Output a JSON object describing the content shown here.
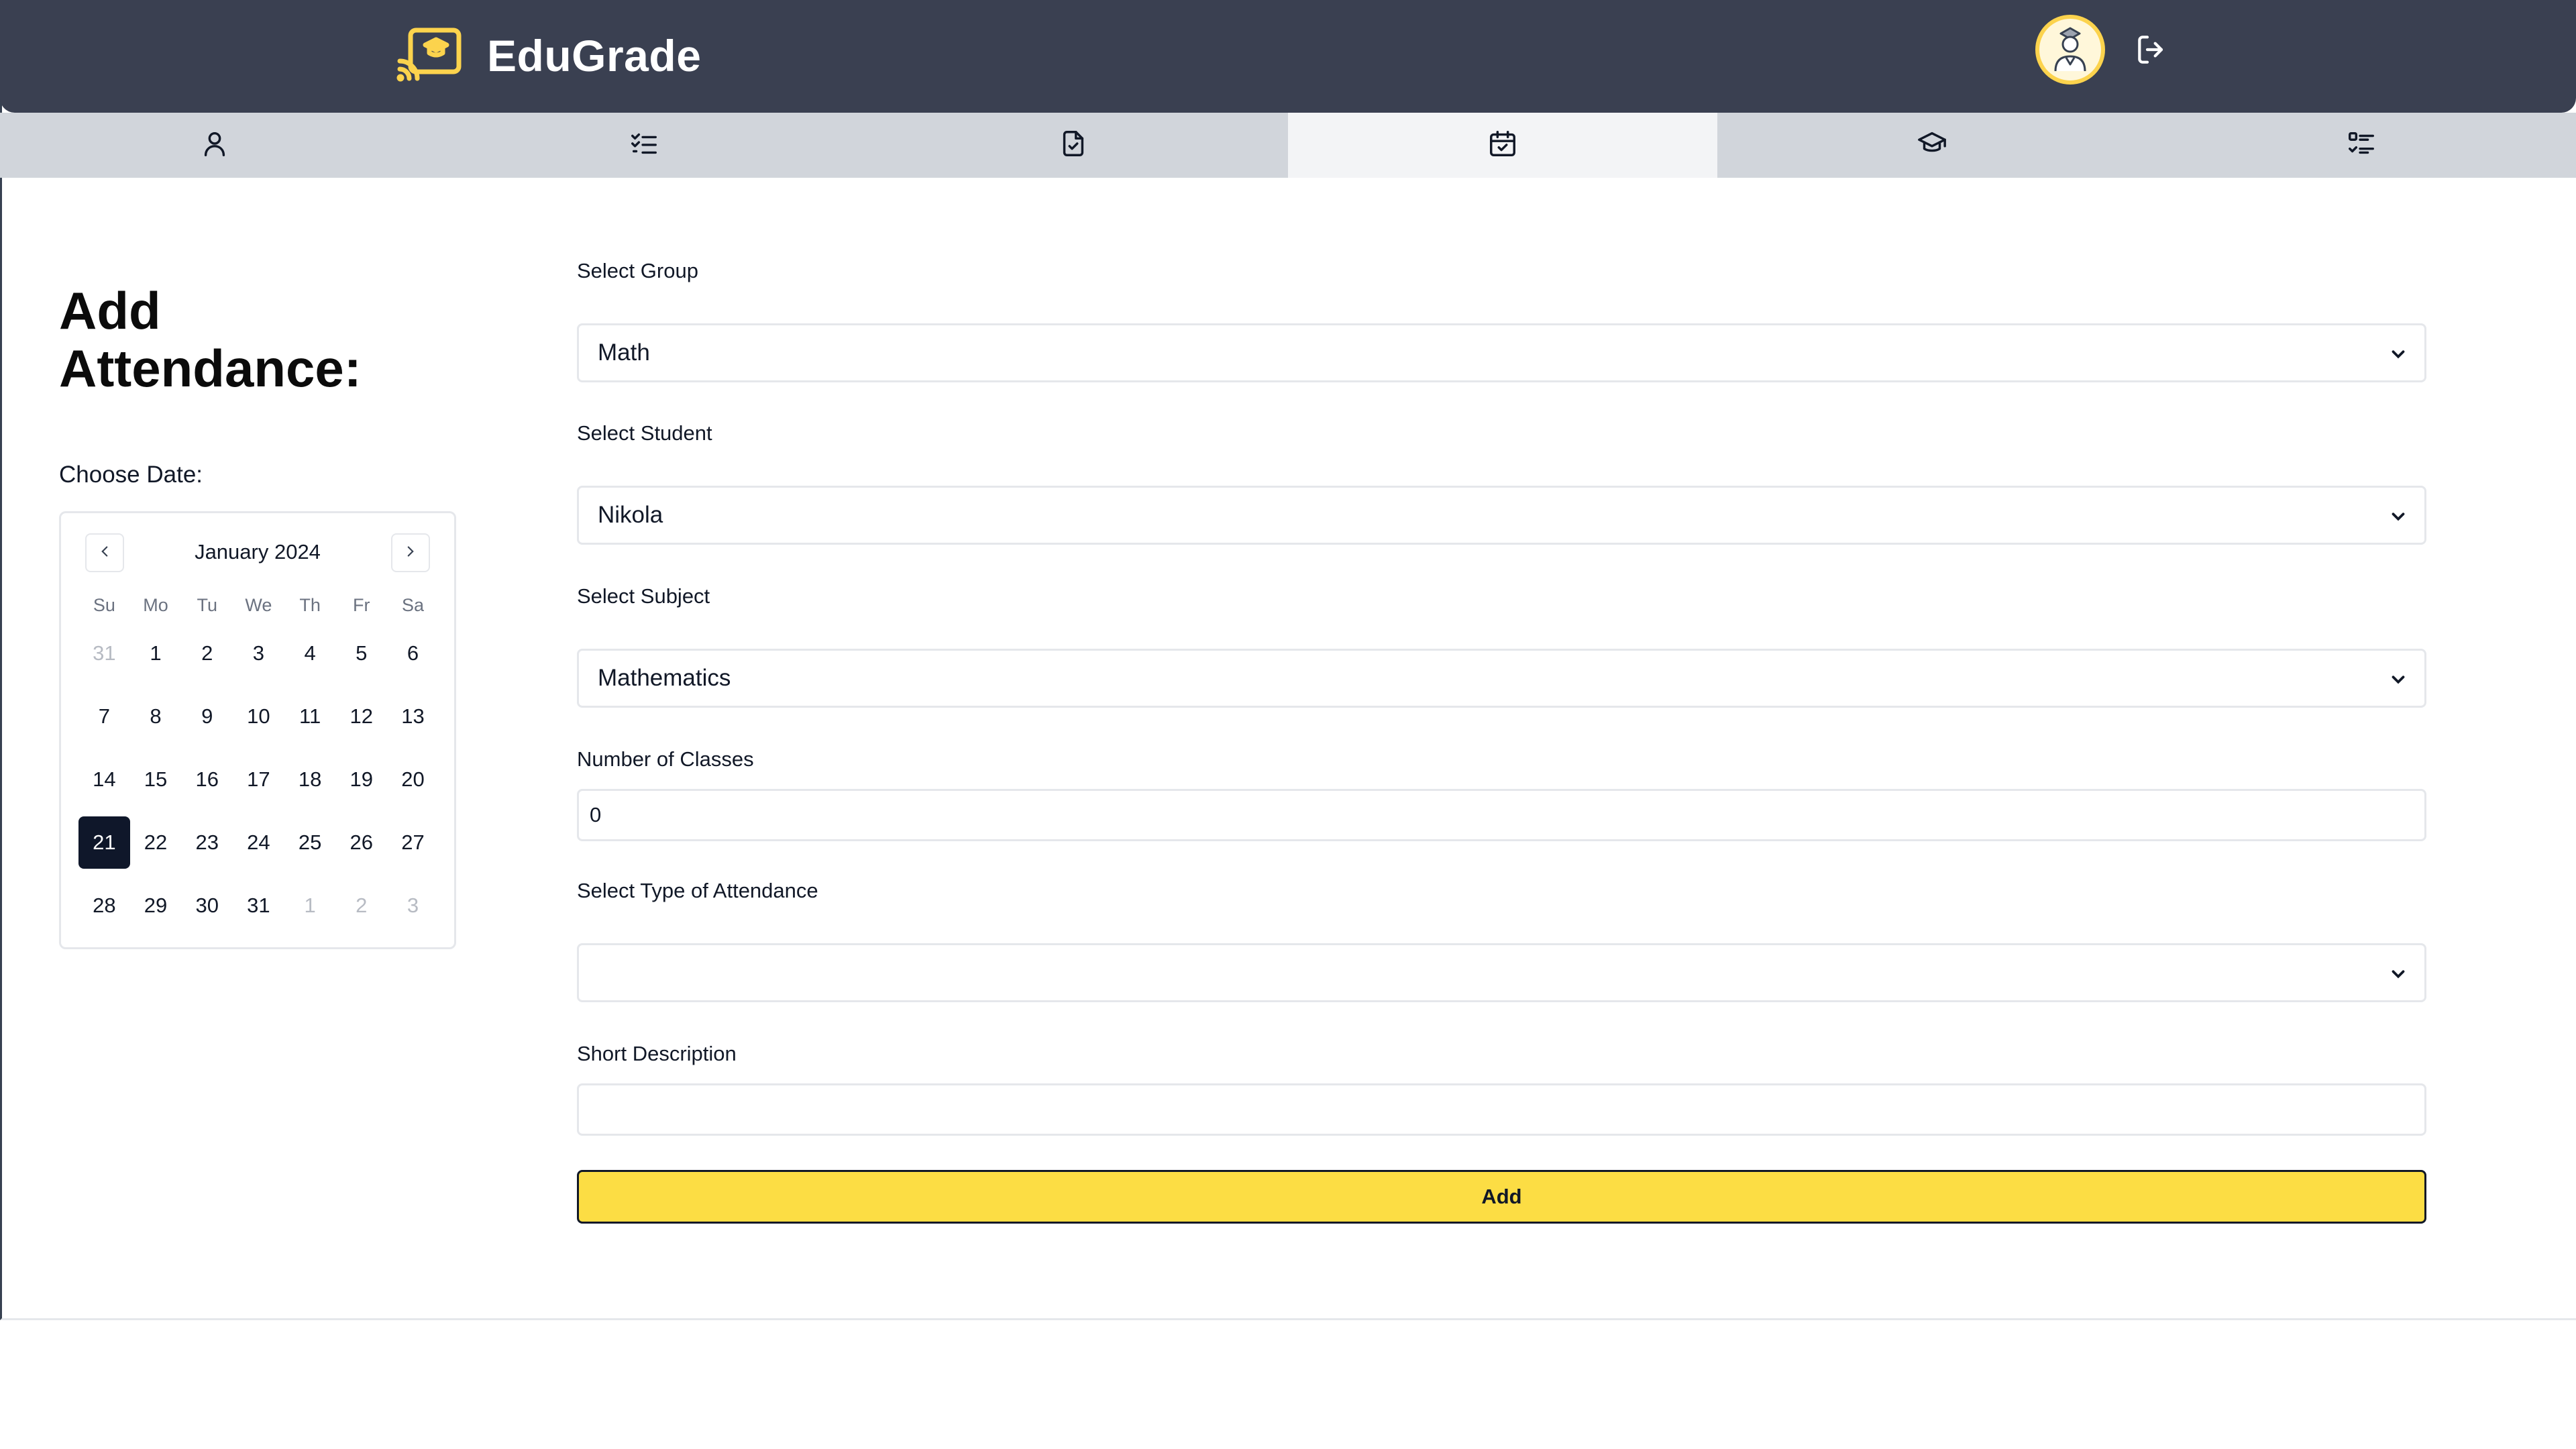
{
  "app": {
    "name": "EduGrade"
  },
  "header": {
    "avatar_icon": "student-avatar-icon",
    "logout_icon": "logout-icon"
  },
  "tabs": [
    {
      "icon": "user-icon",
      "active": false
    },
    {
      "icon": "checklist-icon",
      "active": false
    },
    {
      "icon": "document-check-icon",
      "active": false
    },
    {
      "icon": "calendar-check-icon",
      "active": true
    },
    {
      "icon": "graduation-cap-icon",
      "active": false
    },
    {
      "icon": "list-check-icon",
      "active": false
    }
  ],
  "page": {
    "title_line1": "Add",
    "title_line2": "Attendance:",
    "choose_date_label": "Choose Date:"
  },
  "calendar": {
    "month_label": "January 2024",
    "weekdays": [
      "Su",
      "Mo",
      "Tu",
      "We",
      "Th",
      "Fr",
      "Sa"
    ],
    "weeks": [
      [
        {
          "d": "31",
          "m": true
        },
        {
          "d": "1"
        },
        {
          "d": "2"
        },
        {
          "d": "3"
        },
        {
          "d": "4"
        },
        {
          "d": "5"
        },
        {
          "d": "6"
        }
      ],
      [
        {
          "d": "7"
        },
        {
          "d": "8"
        },
        {
          "d": "9"
        },
        {
          "d": "10"
        },
        {
          "d": "11"
        },
        {
          "d": "12"
        },
        {
          "d": "13"
        }
      ],
      [
        {
          "d": "14"
        },
        {
          "d": "15"
        },
        {
          "d": "16"
        },
        {
          "d": "17"
        },
        {
          "d": "18"
        },
        {
          "d": "19"
        },
        {
          "d": "20"
        }
      ],
      [
        {
          "d": "21",
          "s": true
        },
        {
          "d": "22"
        },
        {
          "d": "23"
        },
        {
          "d": "24"
        },
        {
          "d": "25"
        },
        {
          "d": "26"
        },
        {
          "d": "27"
        }
      ],
      [
        {
          "d": "28"
        },
        {
          "d": "29"
        },
        {
          "d": "30"
        },
        {
          "d": "31"
        },
        {
          "d": "1",
          "m": true
        },
        {
          "d": "2",
          "m": true
        },
        {
          "d": "3",
          "m": true
        }
      ]
    ],
    "selected_day": "21"
  },
  "form": {
    "group_label": "Select Group",
    "group_value": "Math",
    "student_label": "Select Student",
    "student_value": "Nikola",
    "subject_label": "Select Subject",
    "subject_value": "Mathematics",
    "classes_label": "Number of Classes",
    "classes_value": "0",
    "attendance_type_label": "Select Type of Attendance",
    "attendance_type_value": "",
    "description_label": "Short Description",
    "description_value": "",
    "submit_label": "Add"
  },
  "colors": {
    "header_bg": "#3a4051",
    "accent_yellow": "#fcdd44",
    "tab_bar_bg": "#d1d5db",
    "active_tab_bg": "#f3f4f6",
    "selected_day_bg": "#0f172a"
  }
}
